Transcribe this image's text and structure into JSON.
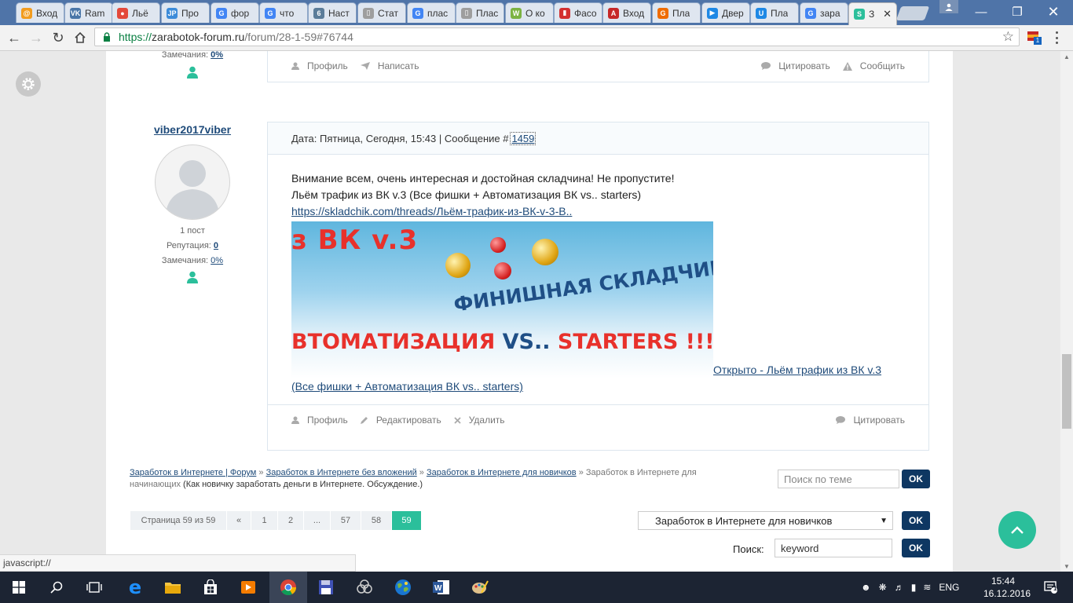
{
  "browser": {
    "tabs": [
      {
        "label": "Вход",
        "color": "#f29c1f",
        "glyph": "@"
      },
      {
        "label": "Ram",
        "color": "#4a76a8",
        "glyph": "VK"
      },
      {
        "label": "Льё",
        "color": "#e3493b",
        "glyph": "●"
      },
      {
        "label": "Про",
        "color": "#3c8bd9",
        "glyph": "JP"
      },
      {
        "label": "фор",
        "color": "#4285f4",
        "glyph": "G"
      },
      {
        "label": "что",
        "color": "#4285f4",
        "glyph": "G"
      },
      {
        "label": "Наст",
        "color": "#5b7c99",
        "glyph": "6"
      },
      {
        "label": "Стат",
        "color": "#9e9e9e",
        "glyph": "▯"
      },
      {
        "label": "плас",
        "color": "#4285f4",
        "glyph": "G"
      },
      {
        "label": "Плас",
        "color": "#9e9e9e",
        "glyph": "▯"
      },
      {
        "label": "О ко",
        "color": "#7cb342",
        "glyph": "W"
      },
      {
        "label": "Фасо",
        "color": "#d32f2f",
        "glyph": "▮"
      },
      {
        "label": "Вход",
        "color": "#c62828",
        "glyph": "A"
      },
      {
        "label": "Пла",
        "color": "#ef6c00",
        "glyph": "G"
      },
      {
        "label": "Двер",
        "color": "#1e88e5",
        "glyph": "▶"
      },
      {
        "label": "Пла",
        "color": "#1e88e5",
        "glyph": "U"
      },
      {
        "label": "зара",
        "color": "#4285f4",
        "glyph": "G"
      },
      {
        "label": "З",
        "color": "#2bbf9b",
        "glyph": "S"
      }
    ],
    "url_protocol": "https://",
    "url_host": "zarabotok-forum.ru",
    "url_path": "/forum/28-1-59#76744",
    "status_text": "javascript://"
  },
  "prev_post": {
    "remarks_label": "Замечания:",
    "remarks_value": "0%",
    "actions_left": [
      "Профиль",
      "Написать"
    ],
    "actions_right": [
      "Цитировать",
      "Сообщить"
    ]
  },
  "post": {
    "username": "viber2017viber",
    "posts_count": "1 пост",
    "reputation_label": "Репутация:",
    "reputation_value": "0",
    "remarks_label": "Замечания:",
    "remarks_value": "0%",
    "date_text": "Дата: Пятница, Сегодня, 15:43 | Сообщение #",
    "message_number": "1459",
    "line1": "Внимание всем, очень интересная и достойная складчина! Не пропустите!",
    "line2": "Льём трафик из ВК v.3 (Все фишки + Автоматизация ВК vs.. starters)",
    "link": "https://skladchik.com/threads/Льём-трафик-из-ВК-v-3-В..",
    "banner_text_1": "з ВК v.3",
    "banner_text_2": "ФИНИШНАЯ СКЛАДЧИНА",
    "banner_text_3a": "ВТОМАТИЗАЦИЯ ",
    "banner_text_3b": "VS.. ",
    "banner_text_3c": "STARTERS !!!",
    "open_link_a": "Открыто - Льём трафик из ВК v.3",
    "open_link_b": "(Все фишки + Автоматизация ВК vs.. starters)",
    "actions_left": [
      "Профиль",
      "Редактировать",
      "Удалить"
    ],
    "actions_right": [
      "Цитировать"
    ]
  },
  "breadcrumbs": {
    "c1": "Заработок в Интернете | Форум",
    "sep": " » ",
    "c2": "Заработок в Интернете без вложений",
    "c3": "Заработок в Интернете для новичков",
    "c4": "Заработок в Интернете для начинающих",
    "suffix": " (Как новичку заработать деньги в Интернете. Обсуждение.)"
  },
  "topic_search": {
    "placeholder": "Поиск по теме",
    "ok": "OK"
  },
  "pagination": {
    "label": "Страница 59 из 59",
    "prev": "«",
    "pages": [
      "1",
      "2",
      "...",
      "57",
      "58",
      "59"
    ],
    "current": "59"
  },
  "forum_jump": {
    "selected": "Заработок в Интернете для новичков",
    "ok": "OK"
  },
  "site_search": {
    "label": "Поиск:",
    "value": "keyword",
    "ok": "OK"
  },
  "taskbar": {
    "language": "ENG",
    "time": "15:44",
    "date": "16.12.2016",
    "notifications": "1"
  },
  "colors": {
    "accent": "#2bbf9b",
    "button": "#0e3762",
    "link": "#1f4b7a"
  }
}
